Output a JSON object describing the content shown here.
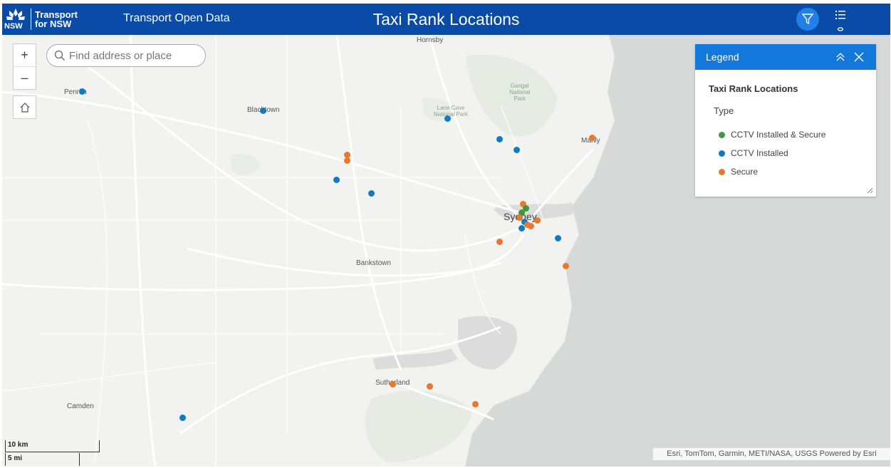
{
  "header": {
    "logo_line1": "Transport",
    "logo_line2": "for NSW",
    "app_name": "Transport Open Data",
    "title": "Taxi Rank Locations"
  },
  "search": {
    "placeholder": "Find address or place"
  },
  "zoom": {
    "in_label": "+",
    "out_label": "–"
  },
  "places": {
    "hornsby": "Hornsby",
    "penrith": "Penrith",
    "blacktown": "Blacktown",
    "lane_cove_line1": "Lane Cove",
    "lane_cove_line2": "National Park",
    "garigal_line1": "Garigal",
    "garigal_line2": "National",
    "garigal_line3": "Park",
    "manly": "Manly",
    "sydney": "Sydney",
    "bankstown": "Bankstown",
    "sutherland": "Sutherland",
    "camden": "Camden"
  },
  "legend": {
    "title": "Legend",
    "layer": "Taxi Rank Locations",
    "field": "Type",
    "items": [
      {
        "label": "CCTV Installed & Secure",
        "color": "#3b9a3e"
      },
      {
        "label": "CCTV Installed",
        "color": "#0f7bc4"
      },
      {
        "label": "Secure",
        "color": "#e8782c"
      }
    ]
  },
  "scale": {
    "metric": "10 km",
    "imperial": "5 mi"
  },
  "attribution": "Esri, TomTom, Garmin, METI/NASA, USGS   Powered by Esri",
  "colors": {
    "header": "#0a4ba8",
    "legend_header": "#1378dc",
    "water": "#d7d8d8"
  }
}
